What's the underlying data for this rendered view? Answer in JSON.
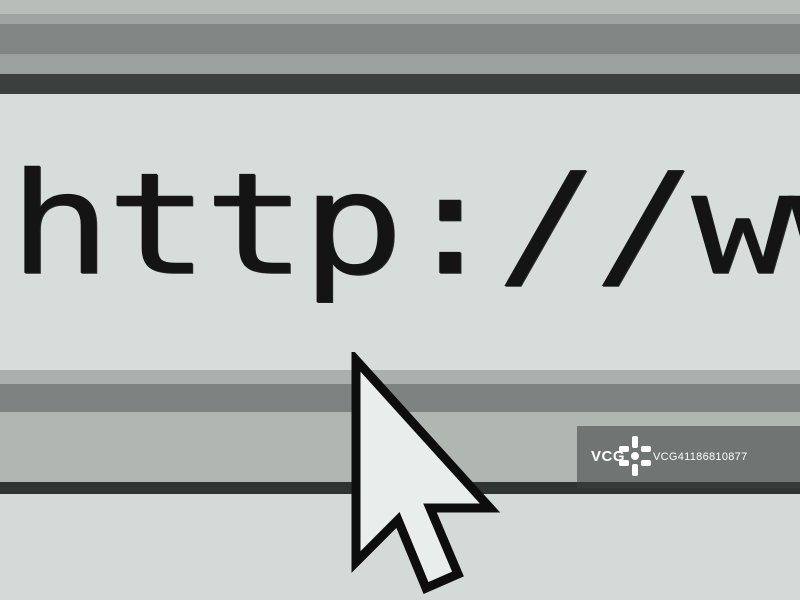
{
  "address_bar": {
    "url_text": "http://www"
  },
  "watermark": {
    "brand": "VCG",
    "id_text": "VCG41186810877"
  },
  "icons": {
    "cursor": "arrow-pointer-icon",
    "watermark_logo": "vcg-logo-icon"
  },
  "colors": {
    "text": "#141414",
    "field_background": "#d6ddda",
    "chrome_dark": "#3b3f3e"
  }
}
